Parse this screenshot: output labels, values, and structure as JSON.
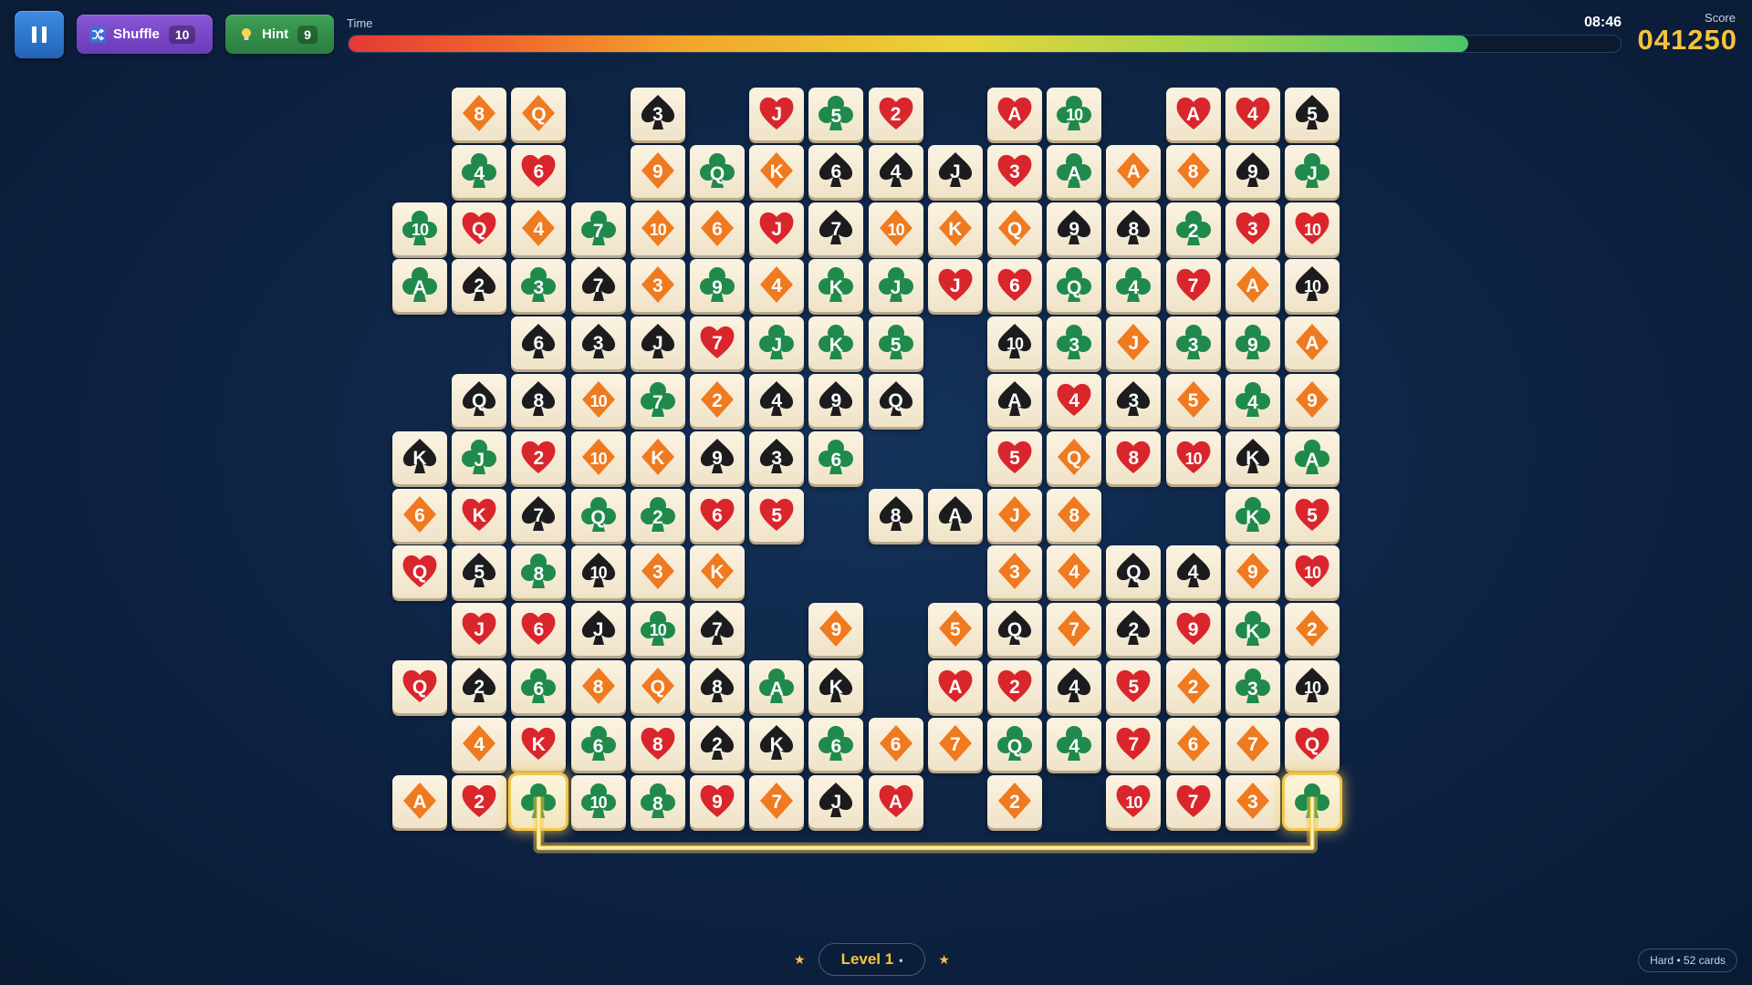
{
  "header": {
    "pause_icon": "pause-icon",
    "shuffle": {
      "label": "Shuffle",
      "count": "10",
      "icon": "shuffle-icon"
    },
    "hint": {
      "label": "Hint",
      "count": "9",
      "icon": "lightbulb-icon"
    },
    "time_label": "Time",
    "time_remaining": "08:46",
    "time_fraction": 0.88,
    "score_label": "Score",
    "score_value": "041250"
  },
  "colors": {
    "heart": "#d9262c",
    "diamond": "#ef7a1f",
    "club": "#1f8a4c",
    "spade": "#1c1c1f",
    "accent": "#f6c33b"
  },
  "board": {
    "selected": [
      [
        12,
        2
      ],
      [
        12,
        15
      ]
    ],
    "rows": [
      [
        null,
        [
          "8",
          "D"
        ],
        [
          "Q",
          "D"
        ],
        null,
        [
          "3",
          "S"
        ],
        null,
        [
          "J",
          "H"
        ],
        [
          "5",
          "C"
        ],
        [
          "2",
          "H"
        ],
        null,
        [
          "A",
          "H"
        ],
        [
          "10",
          "C"
        ],
        null,
        [
          "A",
          "H"
        ],
        [
          "4",
          "H"
        ],
        [
          "5",
          "S"
        ]
      ],
      [
        null,
        [
          "4",
          "C"
        ],
        [
          "6",
          "H"
        ],
        null,
        [
          "9",
          "D"
        ],
        [
          "Q",
          "C"
        ],
        [
          "K",
          "D"
        ],
        [
          "6",
          "S"
        ],
        [
          "4",
          "S"
        ],
        [
          "J",
          "S"
        ],
        [
          "3",
          "H"
        ],
        [
          "A",
          "C"
        ],
        [
          "A",
          "D"
        ],
        [
          "8",
          "D"
        ],
        [
          "9",
          "S"
        ],
        [
          "J",
          "C"
        ]
      ],
      [
        [
          "10",
          "C"
        ],
        [
          "Q",
          "H"
        ],
        [
          "4",
          "D"
        ],
        [
          "7",
          "C"
        ],
        [
          "10",
          "D"
        ],
        [
          "6",
          "D"
        ],
        [
          "J",
          "H"
        ],
        [
          "7",
          "S"
        ],
        [
          "10",
          "D"
        ],
        [
          "K",
          "D"
        ],
        [
          "Q",
          "D"
        ],
        [
          "9",
          "S"
        ],
        [
          "8",
          "S"
        ],
        [
          "2",
          "C"
        ],
        [
          "3",
          "H"
        ],
        [
          "10",
          "H"
        ]
      ],
      [
        [
          "A",
          "C"
        ],
        [
          "2",
          "S"
        ],
        [
          "3",
          "C"
        ],
        [
          "7",
          "S"
        ],
        [
          "3",
          "D"
        ],
        [
          "9",
          "C"
        ],
        [
          "4",
          "D"
        ],
        [
          "K",
          "C"
        ],
        [
          "J",
          "C"
        ],
        [
          "J",
          "H"
        ],
        [
          "6",
          "H"
        ],
        [
          "Q",
          "C"
        ],
        [
          "4",
          "C"
        ],
        [
          "7",
          "H"
        ],
        [
          "A",
          "D"
        ],
        [
          "10",
          "S"
        ]
      ],
      [
        null,
        null,
        [
          "6",
          "S"
        ],
        [
          "3",
          "S"
        ],
        [
          "J",
          "S"
        ],
        [
          "7",
          "H"
        ],
        [
          "J",
          "C"
        ],
        [
          "K",
          "C"
        ],
        [
          "5",
          "C"
        ],
        null,
        [
          "10",
          "S"
        ],
        [
          "3",
          "C"
        ],
        [
          "J",
          "D"
        ],
        [
          "3",
          "C"
        ],
        [
          "9",
          "C"
        ],
        [
          "A",
          "D"
        ]
      ],
      [
        null,
        [
          "Q",
          "S"
        ],
        [
          "8",
          "S"
        ],
        [
          "10",
          "D"
        ],
        [
          "7",
          "C"
        ],
        [
          "2",
          "D"
        ],
        [
          "4",
          "S"
        ],
        [
          "9",
          "S"
        ],
        [
          "Q",
          "S"
        ],
        null,
        [
          "A",
          "S"
        ],
        [
          "4",
          "H"
        ],
        [
          "3",
          "S"
        ],
        [
          "5",
          "D"
        ],
        [
          "4",
          "C"
        ],
        [
          "9",
          "D"
        ]
      ],
      [
        [
          "K",
          "S"
        ],
        [
          "J",
          "C"
        ],
        [
          "2",
          "H"
        ],
        [
          "10",
          "D"
        ],
        [
          "K",
          "D"
        ],
        [
          "9",
          "S"
        ],
        [
          "3",
          "S"
        ],
        [
          "6",
          "C"
        ],
        null,
        null,
        [
          "5",
          "H"
        ],
        [
          "Q",
          "D"
        ],
        [
          "8",
          "H"
        ],
        [
          "10",
          "H"
        ],
        [
          "K",
          "S"
        ],
        [
          "A",
          "C"
        ]
      ],
      [
        [
          "6",
          "D"
        ],
        [
          "K",
          "H"
        ],
        [
          "7",
          "S"
        ],
        [
          "Q",
          "C"
        ],
        [
          "2",
          "C"
        ],
        [
          "6",
          "H"
        ],
        [
          "5",
          "H"
        ],
        null,
        [
          "8",
          "S"
        ],
        [
          "A",
          "S"
        ],
        [
          "J",
          "D"
        ],
        [
          "8",
          "D"
        ],
        null,
        null,
        [
          "K",
          "C"
        ],
        [
          "5",
          "H"
        ]
      ],
      [
        [
          "Q",
          "H"
        ],
        [
          "5",
          "S"
        ],
        [
          "8",
          "C"
        ],
        [
          "10",
          "S"
        ],
        [
          "3",
          "D"
        ],
        [
          "K",
          "D"
        ],
        null,
        null,
        null,
        null,
        [
          "3",
          "D"
        ],
        [
          "4",
          "D"
        ],
        [
          "Q",
          "S"
        ],
        [
          "4",
          "S"
        ],
        [
          "9",
          "D"
        ],
        [
          "10",
          "H"
        ]
      ],
      [
        null,
        [
          "J",
          "H"
        ],
        [
          "6",
          "H"
        ],
        [
          "J",
          "S"
        ],
        [
          "10",
          "C"
        ],
        [
          "7",
          "S"
        ],
        null,
        [
          "9",
          "D"
        ],
        null,
        [
          "5",
          "D"
        ],
        [
          "Q",
          "S"
        ],
        [
          "7",
          "D"
        ],
        [
          "2",
          "S"
        ],
        [
          "9",
          "H"
        ],
        [
          "K",
          "C"
        ],
        [
          "2",
          "D"
        ]
      ],
      [
        [
          "Q",
          "H"
        ],
        [
          "2",
          "S"
        ],
        [
          "6",
          "C"
        ],
        [
          "8",
          "D"
        ],
        [
          "Q",
          "D"
        ],
        [
          "8",
          "S"
        ],
        [
          "A",
          "C"
        ],
        [
          "K",
          "S"
        ],
        null,
        [
          "A",
          "H"
        ],
        [
          "2",
          "H"
        ],
        [
          "4",
          "S"
        ],
        [
          "5",
          "H"
        ],
        [
          "2",
          "D"
        ],
        [
          "3",
          "C"
        ],
        [
          "10",
          "S"
        ]
      ],
      [
        null,
        [
          "4",
          "D"
        ],
        [
          "K",
          "H"
        ],
        [
          "6",
          "C"
        ],
        [
          "8",
          "H"
        ],
        [
          "2",
          "S"
        ],
        [
          "K",
          "S"
        ],
        [
          "6",
          "C"
        ],
        [
          "6",
          "D"
        ],
        [
          "7",
          "D"
        ],
        [
          "Q",
          "C"
        ],
        [
          "4",
          "C"
        ],
        [
          "7",
          "H"
        ],
        [
          "6",
          "D"
        ],
        [
          "7",
          "D"
        ],
        [
          "Q",
          "H"
        ]
      ],
      [
        [
          "A",
          "D"
        ],
        [
          "2",
          "H"
        ],
        [
          "",
          "C"
        ],
        [
          "10",
          "C"
        ],
        [
          "8",
          "C"
        ],
        [
          "9",
          "H"
        ],
        [
          "7",
          "D"
        ],
        [
          "J",
          "S"
        ],
        [
          "A",
          "H"
        ],
        null,
        [
          "2",
          "D"
        ],
        null,
        [
          "10",
          "H"
        ],
        [
          "7",
          "H"
        ],
        [
          "3",
          "D"
        ],
        [
          "",
          "C"
        ]
      ]
    ]
  },
  "footer": {
    "level_label": "Level 1",
    "level_dot": "•",
    "star_left": "★",
    "star_right": "★",
    "mode": "Hard • 52 cards"
  }
}
